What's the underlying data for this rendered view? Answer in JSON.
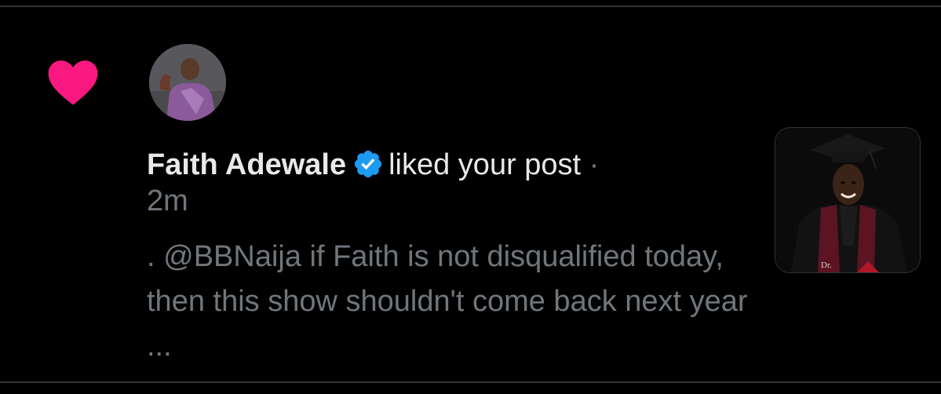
{
  "notification": {
    "type": "like",
    "actor_name": "Faith Adewale",
    "action_text": "liked your post",
    "separator": "·",
    "timestamp": "2m",
    "post_text": ". @BBNaija if Faith is not disqualified today, then this show shouldn't come back next year ...",
    "icons": {
      "like": "heart-icon",
      "verified": "verified-badge-icon"
    },
    "colors": {
      "heart": "#f91880",
      "verified": "#1d9bf0",
      "primary_text": "#e7e9ea",
      "secondary_text": "#71767b",
      "background": "#000000"
    }
  }
}
